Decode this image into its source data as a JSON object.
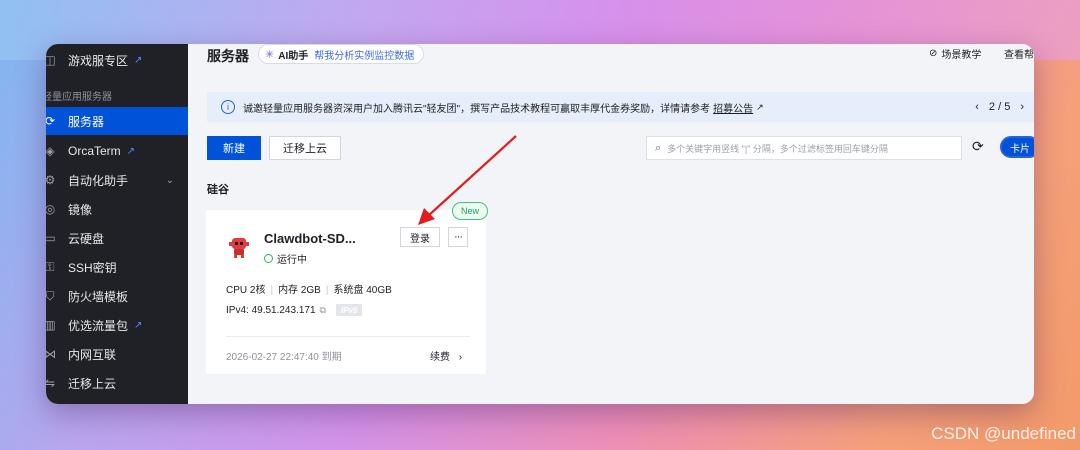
{
  "sidebar": {
    "items": [
      {
        "label": "游戏服专区",
        "external": true
      },
      {
        "label": "服务器",
        "active": true
      },
      {
        "label": "OrcaTerm",
        "external": true
      },
      {
        "label": "自动化助手",
        "expandable": true
      },
      {
        "label": "镜像"
      },
      {
        "label": "云硬盘"
      },
      {
        "label": "SSH密钥"
      },
      {
        "label": "防火墙模板"
      },
      {
        "label": "优选流量包",
        "external": true
      },
      {
        "label": "内网互联"
      },
      {
        "label": "迁移上云"
      }
    ],
    "group_label": "轻量应用服务器",
    "external_icon": "↗",
    "chevron": "⌄"
  },
  "header": {
    "title": "服务器",
    "ai_label": "AI助手",
    "ai_hint": "帮我分析实例监控数据",
    "scene_tutorial": "场景教学",
    "view_help": "查看帮"
  },
  "notice": {
    "text": "诚邀轻量应用服务器资深用户加入腾讯云\"轻友团\"，撰写产品技术教程可赢取丰厚代金券奖励，详情请参考",
    "link": "招募公告",
    "pager": "2 / 5",
    "prev": "‹",
    "next": "›"
  },
  "toolbar": {
    "new_label": "新建",
    "migrate_label": "迁移上云",
    "search_placeholder": "多个关键字用竖线 \"|\" 分隔，多个过滤标签用回车键分隔",
    "view_label": "卡片"
  },
  "region": "硅谷",
  "instance": {
    "badge": "New",
    "name": "Clawdbot-SD...",
    "status": "运行中",
    "login_label": "登录",
    "more_label": "···",
    "cpu": "CPU 2核",
    "memory": "内存 2GB",
    "disk": "系统盘 40GB",
    "ipv4": "IPv4: 49.51.243.171",
    "ipv6": "IPv6",
    "expire": "2026-02-27 22:47:40 到期",
    "renew": "续费",
    "renew_chevron": "›"
  },
  "watermark": "CSDN @undefined",
  "colors": {
    "primary": "#0052d9",
    "sidebar_bg": "#1f2126",
    "running": "#2bb168",
    "annotation_arrow": "#e01e1e"
  }
}
